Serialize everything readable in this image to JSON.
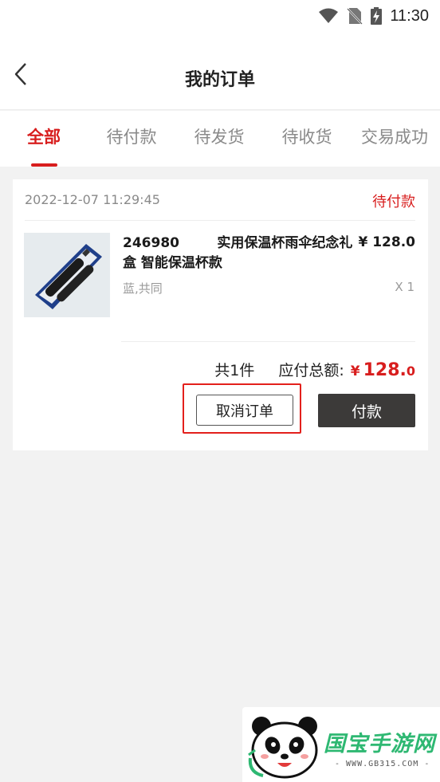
{
  "status_bar": {
    "time": "11:30"
  },
  "header": {
    "title": "我的订单"
  },
  "tabs": [
    {
      "label": "全部",
      "active": true
    },
    {
      "label": "待付款",
      "active": false
    },
    {
      "label": "待发货",
      "active": false
    },
    {
      "label": "待收货",
      "active": false
    },
    {
      "label": "交易成功",
      "active": false
    }
  ],
  "order": {
    "time": "2022-12-07 11:29:45",
    "status": "待付款",
    "product": {
      "name": "246980        实用保温杯雨伞纪念礼盒 智能保温杯款",
      "price": "¥ 128.0",
      "spec": "蓝,共同",
      "qty": "X 1"
    },
    "summary": {
      "count": "共1件",
      "total_label": "应付总额:",
      "currency": "¥",
      "amount_int": "128.",
      "amount_dec": "0"
    },
    "actions": {
      "cancel_label": "取消订单",
      "pay_label": "付款"
    }
  },
  "watermark": {
    "brand": "国宝手游网",
    "url": "- WWW.GB315.COM -"
  },
  "colors": {
    "accent": "#d81e1e",
    "pay_button": "#3c3a39",
    "highlight": "#e3201c"
  }
}
